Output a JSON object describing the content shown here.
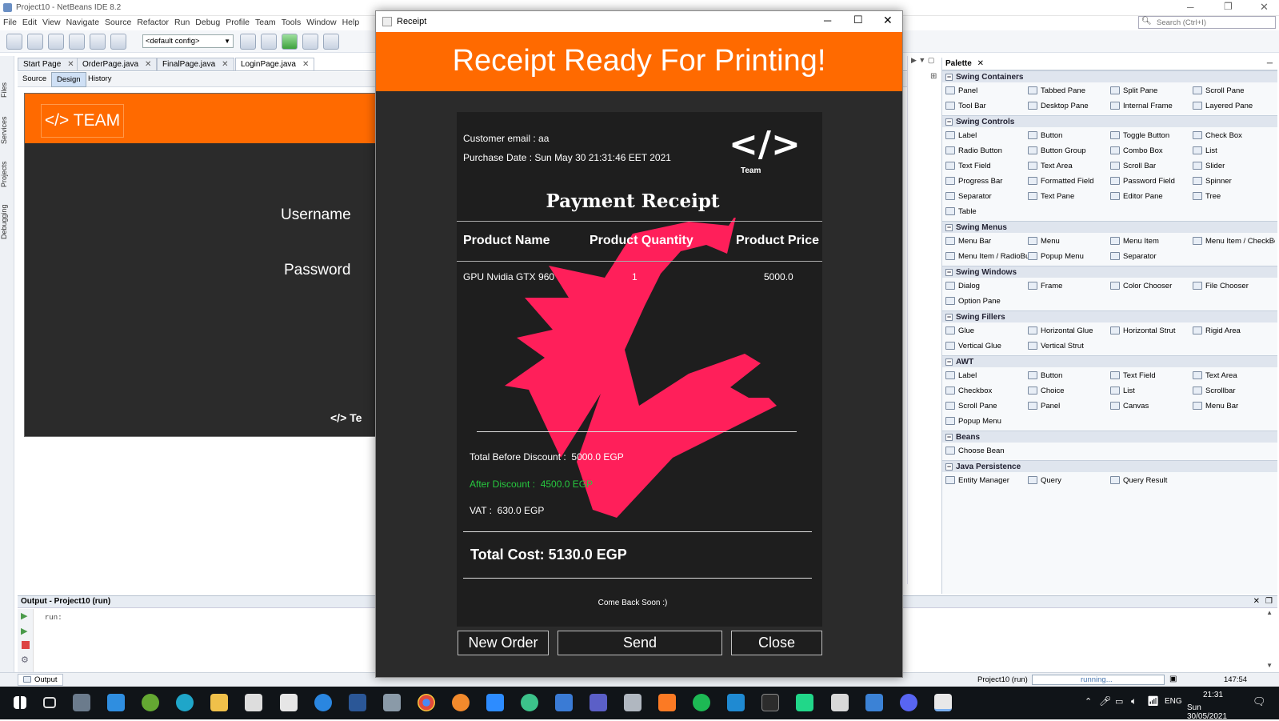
{
  "ide": {
    "title": "Project10 - NetBeans IDE 8.2",
    "menu": [
      "File",
      "Edit",
      "View",
      "Navigate",
      "Source",
      "Refactor",
      "Run",
      "Debug",
      "Profile",
      "Team",
      "Tools",
      "Window",
      "Help"
    ],
    "config": "<default config>",
    "search_placeholder": "Search (Ctrl+I)",
    "editor_tabs": [
      {
        "label": "Start Page"
      },
      {
        "label": "OrderPage.java"
      },
      {
        "label": "FinalPage.java"
      },
      {
        "label": "LoginPage.java"
      }
    ],
    "view_tabs": [
      "Source",
      "Design",
      "History"
    ],
    "side_tabs": [
      "Files",
      "Services",
      "Projects",
      "Debugging"
    ],
    "design": {
      "team_label": "</> TEAM",
      "username_label": "Username",
      "password_label": "Password",
      "footer_label": "</> Te"
    },
    "output": {
      "title": "Output - Project10 (run)",
      "text": "run:",
      "tab": "Output"
    },
    "status": {
      "project": "Project10 (run)",
      "progress": "running...",
      "position": "147:54"
    }
  },
  "palette": {
    "title": "Palette",
    "sections": [
      {
        "name": "Swing Containers",
        "items": [
          "Panel",
          "Tabbed Pane",
          "Split Pane",
          "Scroll Pane",
          "Tool Bar",
          "Desktop Pane",
          "Internal Frame",
          "Layered Pane"
        ]
      },
      {
        "name": "Swing Controls",
        "items": [
          "Label",
          "Button",
          "Toggle Button",
          "Check Box",
          "Radio Button",
          "Button Group",
          "Combo Box",
          "List",
          "Text Field",
          "Text Area",
          "Scroll Bar",
          "Slider",
          "Progress Bar",
          "Formatted Field",
          "Password Field",
          "Spinner",
          "Separator",
          "Text Pane",
          "Editor Pane",
          "Tree",
          "Table"
        ]
      },
      {
        "name": "Swing Menus",
        "items": [
          "Menu Bar",
          "Menu",
          "Menu Item",
          "Menu Item / CheckBox",
          "Menu Item / RadioButton",
          "Popup Menu",
          "Separator"
        ]
      },
      {
        "name": "Swing Windows",
        "items": [
          "Dialog",
          "Frame",
          "Color Chooser",
          "File Chooser",
          "Option Pane"
        ]
      },
      {
        "name": "Swing Fillers",
        "items": [
          "Glue",
          "Horizontal Glue",
          "Horizontal Strut",
          "Rigid Area",
          "Vertical Glue",
          "Vertical Strut"
        ]
      },
      {
        "name": "AWT",
        "items": [
          "Label",
          "Button",
          "Text Field",
          "Text Area",
          "Checkbox",
          "Choice",
          "List",
          "Scrollbar",
          "Scroll Pane",
          "Panel",
          "Canvas",
          "Menu Bar",
          "Popup Menu"
        ]
      },
      {
        "name": "Beans",
        "items": [
          "Choose Bean"
        ]
      },
      {
        "name": "Java Persistence",
        "items": [
          "Entity Manager",
          "Query",
          "Query Result"
        ]
      }
    ]
  },
  "receipt": {
    "window_title": "Receipt",
    "banner": "Receipt Ready For Printing!",
    "customer_email": "Customer email : aa",
    "purchase_date": "Purchase Date : Sun May 30 21:31:46 EET 2021",
    "logo_symbol": "</>",
    "logo_text": "Team",
    "heading": "Payment Receipt",
    "columns": [
      "Product Name",
      "Product Quantity",
      "Product Price"
    ],
    "rows": [
      {
        "name": "GPU Nvidia GTX 960",
        "qty": "1",
        "price": "5000.0"
      }
    ],
    "total_before": "Total Before Discount :  5000.0 EGP",
    "after_discount": "After Discount :  4500.0 EGP",
    "vat": "VAT :  630.0 EGP",
    "total_cost": "Total Cost: 5130.0 EGP",
    "come_back": "Come Back Soon :)",
    "buttons": {
      "new_order": "New Order",
      "send": "Send",
      "close": "Close"
    },
    "colors": {
      "banner": "#ff6a00",
      "panel": "#1e1e1e",
      "accent": "#ff1f5a",
      "discount": "#27c93f"
    }
  },
  "taskbar": {
    "lang": "ENG",
    "time": "21:31",
    "date": "Sun 30/05/2021"
  }
}
